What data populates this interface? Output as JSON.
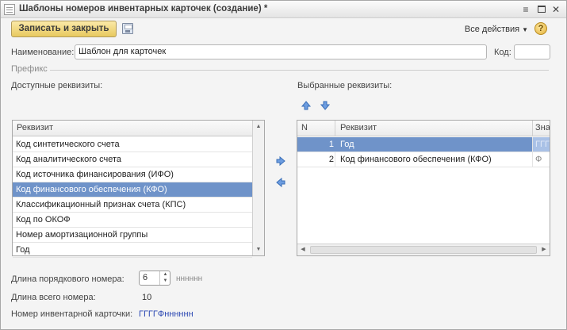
{
  "window": {
    "title": "Шаблоны номеров инвентарных карточек (создание) *"
  },
  "toolbar": {
    "save_close_label": "Записать и закрыть",
    "all_actions_label": "Все действия",
    "help_label": "?"
  },
  "form": {
    "name_label": "Наименование:",
    "name_value": "Шаблон для карточек",
    "code_label": "Код:",
    "code_value": ""
  },
  "prefix": {
    "section_label": "Префикс",
    "available_label": "Доступные реквизиты:",
    "selected_label": "Выбранные реквизиты:"
  },
  "available_table": {
    "header": "Реквизит",
    "rows": [
      "Код синтетического счета",
      "Код аналитического счета",
      "Код источника финансирования (ИФО)",
      "Код финансового обеспечения (КФО)",
      "Классификационный признак счета (КПС)",
      "Код по ОКОФ",
      "Номер амортизационной группы",
      "Год"
    ],
    "selected_index": 3
  },
  "selected_table": {
    "headers": [
      "N",
      "Реквизит",
      "Значе"
    ],
    "rows": [
      {
        "n": "1",
        "name": "Год",
        "value": "ГГГГ"
      },
      {
        "n": "2",
        "name": "Код финансового обеспечения (КФО)",
        "value": "Ф"
      }
    ],
    "selected_index": 0
  },
  "bottom": {
    "seq_length_label": "Длина порядкового номера:",
    "seq_length_value": "6",
    "seq_mask": "нннннн",
    "total_length_label": "Длина всего номера:",
    "total_length_value": "10",
    "card_number_label": "Номер инвентарной карточки:",
    "card_number_value": "ГГГГФнннннн"
  },
  "colors": {
    "accent_button": "#e8c95f",
    "selection": "#6f93c9",
    "link_blue": "#2d49b3"
  }
}
